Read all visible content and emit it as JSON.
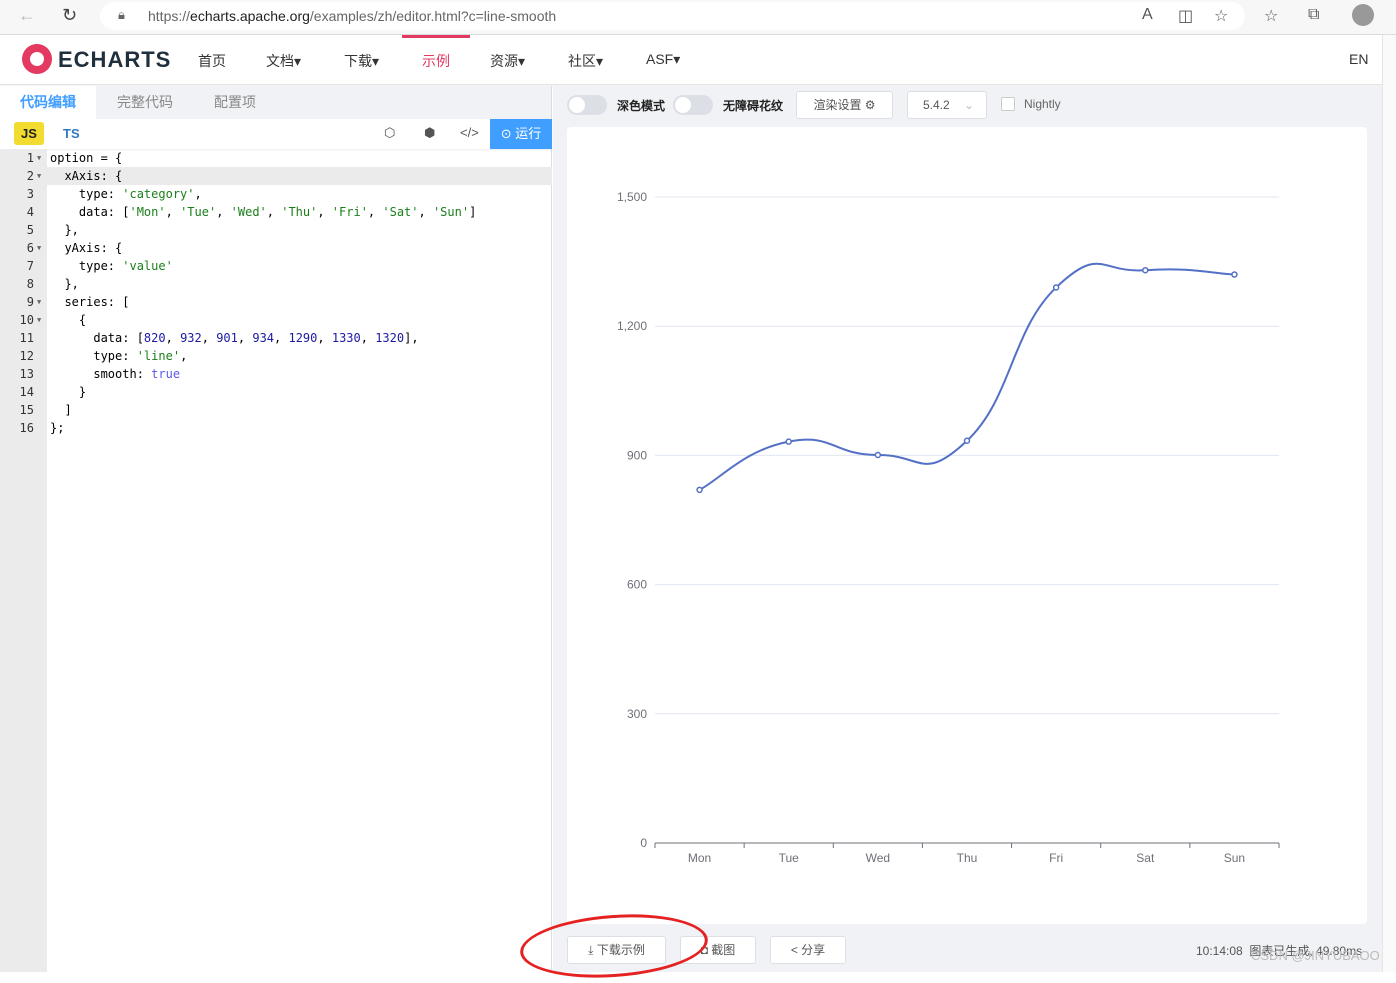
{
  "browser": {
    "url_prefix": "https://",
    "url_domain": "echarts.apache.org",
    "url_path": "/examples/zh/editor.html?c=line-smooth"
  },
  "nav": {
    "logo": "ECHARTS",
    "items": [
      "首页",
      "文档▾",
      "下载▾",
      "示例",
      "资源▾",
      "社区▾",
      "ASF▾"
    ],
    "active": "示例",
    "lang": "EN"
  },
  "editor": {
    "tabs": [
      "代码编辑",
      "完整代码",
      "配置项"
    ],
    "js_label": "JS",
    "ts_label": "TS",
    "run_label": "运行",
    "current_line": 2,
    "lines": [
      [
        [
          "plain",
          "option = {"
        ]
      ],
      [
        [
          "plain",
          "  xAxis: {"
        ]
      ],
      [
        [
          "plain",
          "    type: "
        ],
        [
          "str",
          "'category'"
        ],
        [
          "plain",
          ","
        ]
      ],
      [
        [
          "plain",
          "    data: ["
        ],
        [
          "str",
          "'Mon'"
        ],
        [
          "plain",
          ", "
        ],
        [
          "str",
          "'Tue'"
        ],
        [
          "plain",
          ", "
        ],
        [
          "str",
          "'Wed'"
        ],
        [
          "plain",
          ", "
        ],
        [
          "str",
          "'Thu'"
        ],
        [
          "plain",
          ", "
        ],
        [
          "str",
          "'Fri'"
        ],
        [
          "plain",
          ", "
        ],
        [
          "str",
          "'Sat'"
        ],
        [
          "plain",
          ", "
        ],
        [
          "str",
          "'Sun'"
        ],
        [
          "plain",
          "]"
        ]
      ],
      [
        [
          "plain",
          "  },"
        ]
      ],
      [
        [
          "plain",
          "  yAxis: {"
        ]
      ],
      [
        [
          "plain",
          "    type: "
        ],
        [
          "str",
          "'value'"
        ]
      ],
      [
        [
          "plain",
          "  },"
        ]
      ],
      [
        [
          "plain",
          "  series: ["
        ]
      ],
      [
        [
          "plain",
          "    {"
        ]
      ],
      [
        [
          "plain",
          "      data: ["
        ],
        [
          "num",
          "820"
        ],
        [
          "plain",
          ", "
        ],
        [
          "num",
          "932"
        ],
        [
          "plain",
          ", "
        ],
        [
          "num",
          "901"
        ],
        [
          "plain",
          ", "
        ],
        [
          "num",
          "934"
        ],
        [
          "plain",
          ", "
        ],
        [
          "num",
          "1290"
        ],
        [
          "plain",
          ", "
        ],
        [
          "num",
          "1330"
        ],
        [
          "plain",
          ", "
        ],
        [
          "num",
          "1320"
        ],
        [
          "plain",
          "],"
        ]
      ],
      [
        [
          "plain",
          "      type: "
        ],
        [
          "str",
          "'line'"
        ],
        [
          "plain",
          ","
        ]
      ],
      [
        [
          "plain",
          "      smooth: "
        ],
        [
          "kw",
          "true"
        ]
      ],
      [
        [
          "plain",
          "    }"
        ]
      ],
      [
        [
          "plain",
          "  ]"
        ]
      ],
      [
        [
          "plain",
          "};"
        ]
      ]
    ],
    "foldable": [
      1,
      2,
      6,
      9,
      10
    ]
  },
  "preview": {
    "dark_mode_label": "深色模式",
    "dark_mode_on": false,
    "aria_label": "无障碍花纹",
    "aria_on": false,
    "render_settings_label": "渲染设置",
    "version": "5.4.2",
    "nightly_label": "Nightly",
    "nightly_checked": false,
    "download_label": "下载示例",
    "screenshot_label": "截图",
    "share_label": "分享",
    "status_time": "10:14:08",
    "status_text": "图表已生成, 49.80ms",
    "watermark": "CSDN @JINYUBAOO"
  },
  "chart_data": {
    "type": "line",
    "smooth": true,
    "categories": [
      "Mon",
      "Tue",
      "Wed",
      "Thu",
      "Fri",
      "Sat",
      "Sun"
    ],
    "values": [
      820,
      932,
      901,
      934,
      1290,
      1330,
      1320
    ],
    "ylim": [
      0,
      1500
    ],
    "yticks": [
      0,
      300,
      600,
      900,
      1200,
      1500
    ],
    "ytick_labels": [
      "0",
      "300",
      "600",
      "900",
      "1,200",
      "1,500"
    ],
    "grid": true,
    "color": "#5470c6"
  }
}
